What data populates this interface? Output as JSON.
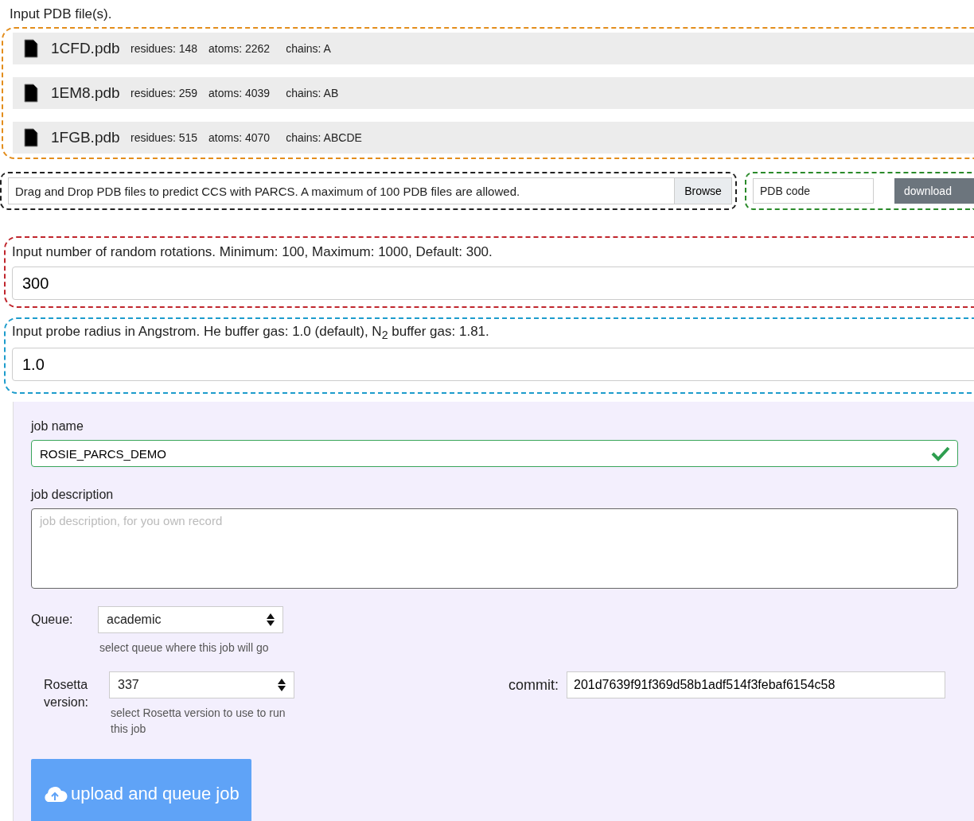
{
  "files_section": {
    "title": "Input PDB file(s).",
    "files": [
      {
        "name": "1CFD.pdb",
        "residues": "residues: 148",
        "atoms": "atoms: 2262",
        "chains": "chains: A"
      },
      {
        "name": "1EM8.pdb",
        "residues": "residues: 259",
        "atoms": "atoms: 4039",
        "chains": "chains: AB"
      },
      {
        "name": "1FGB.pdb",
        "residues": "residues: 515",
        "atoms": "atoms: 4070",
        "chains": "chains: ABCDE"
      }
    ]
  },
  "dropzone": {
    "text": "Drag and Drop PDB files to predict CCS with PARCS. A maximum of 100 PDB files are allowed.",
    "button": "Browse"
  },
  "pdb_download": {
    "placeholder": "PDB code",
    "button": "download"
  },
  "rotations": {
    "label": "Input number of random rotations. Minimum: 100, Maximum: 1000, Default: 300.",
    "value": "300"
  },
  "probe_radius": {
    "label": "Input probe radius in Angstrom. He buffer gas: 1.0 (default), N$_{2}$ buffer gas: 1.81.",
    "value": "1.0"
  },
  "job_form": {
    "job_name": {
      "label": "job name",
      "value": "ROSIE_PARCS_DEMO",
      "valid": true
    },
    "job_description": {
      "label": "job description",
      "placeholder": "job description, for you own record"
    },
    "queue": {
      "label": "Queue:",
      "value": "academic",
      "help": "select queue where this job will go"
    },
    "rosetta_version": {
      "label": "Rosetta version:",
      "value": "337",
      "help": "select Rosetta version to use to run this job"
    },
    "commit": {
      "label": "commit:",
      "value": "201d7639f91f369d58b1adf514f3febaf6154c58"
    },
    "submit": "upload and queue job"
  }
}
